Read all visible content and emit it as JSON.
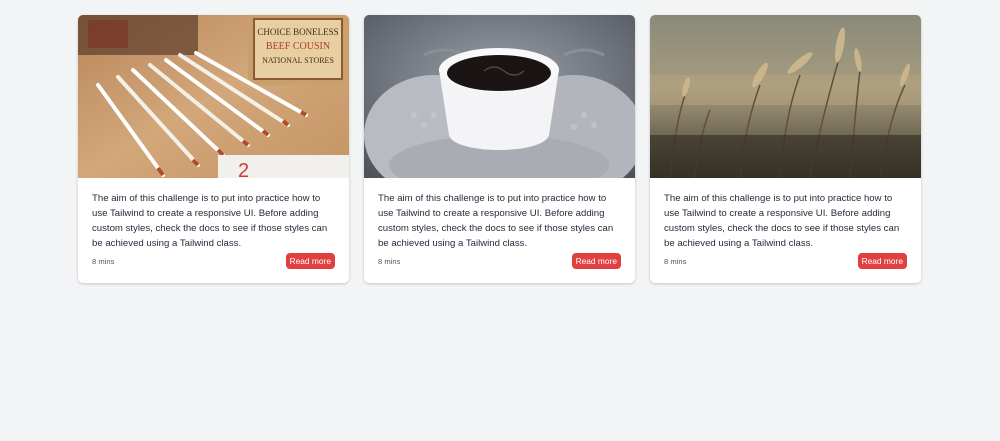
{
  "cards": [
    {
      "image_alt": "pencils on wooden table",
      "text": "The aim of this challenge is to put into practice how to use Tailwind to create a responsive UI. Before adding custom styles, check the docs to see if those styles can be achieved using a Tailwind class.",
      "time": "8 mins",
      "button_label": "Read more"
    },
    {
      "image_alt": "cup of coffee held in knitted mittens",
      "text": "The aim of this challenge is to put into practice how to use Tailwind to create a responsive UI. Before adding custom styles, check the docs to see if those styles can be achieved using a Tailwind class.",
      "time": "8 mins",
      "button_label": "Read more"
    },
    {
      "image_alt": "wheat field at sunset",
      "text": "The aim of this challenge is to put into practice how to use Tailwind to create a responsive UI. Before adding custom styles, check the docs to see if those styles can be achieved using a Tailwind class.",
      "time": "8 mins",
      "button_label": "Read more"
    }
  ],
  "colors": {
    "background": "#f3f4f6",
    "card": "#ffffff",
    "button": "#e04040",
    "text": "#1f2937",
    "muted": "#4b5563"
  }
}
